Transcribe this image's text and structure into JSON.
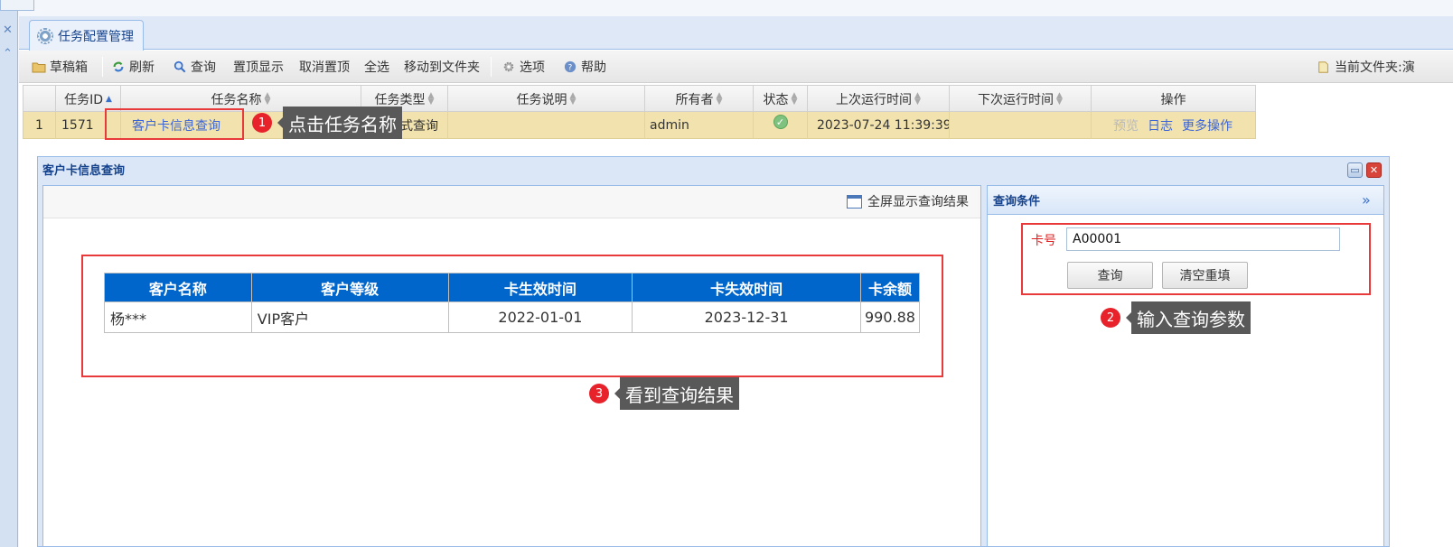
{
  "tab": {
    "label": "任务配置管理"
  },
  "toolbar": {
    "drafts": "草稿箱",
    "refresh": "刷新",
    "search": "查询",
    "pin_top": "置顶显示",
    "unpin_top": "取消置顶",
    "select_all": "全选",
    "move_to_folder": "移动到文件夹",
    "options": "选项",
    "help": "帮助",
    "current_folder": "当前文件夹:演"
  },
  "grid": {
    "columns": [
      "任务ID",
      "任务名称",
      "任务类型",
      "任务说明",
      "所有者",
      "状态",
      "上次运行时间",
      "下次运行时间",
      "操作"
    ],
    "row": {
      "index": "1",
      "task_id": "1571",
      "task_name": "客户卡信息查询",
      "task_type": "式查询",
      "task_desc": "",
      "owner": "admin",
      "last_run": "2023-07-24 11:39:39",
      "next_run": "",
      "actions": {
        "preview": "预览",
        "log": "日志",
        "more": "更多操作"
      }
    }
  },
  "annotations": {
    "step1": {
      "num": "1",
      "text": "点击任务名称"
    },
    "step2": {
      "num": "2",
      "text": "输入查询参数"
    },
    "step3": {
      "num": "3",
      "text": "看到查询结果"
    }
  },
  "window": {
    "title": "客户卡信息查询",
    "fullscreen_label": "全屏显示查询结果",
    "result_table": {
      "headers": [
        "客户名称",
        "客户等级",
        "卡生效时间",
        "卡失效时间",
        "卡余额"
      ],
      "rows": [
        [
          "杨***",
          "VIP客户",
          "2022-01-01",
          "2023-12-31",
          "990.88"
        ]
      ]
    },
    "query_panel": {
      "title": "查询条件",
      "card_label": "卡号",
      "card_value": "A00001",
      "query_button": "查询",
      "reset_button": "清空重填"
    }
  },
  "colors": {
    "accent": "#0066cc",
    "highlight_row": "#f2e3ae",
    "annotation_red": "#e8222a",
    "tooltip_bg": "#595959"
  }
}
